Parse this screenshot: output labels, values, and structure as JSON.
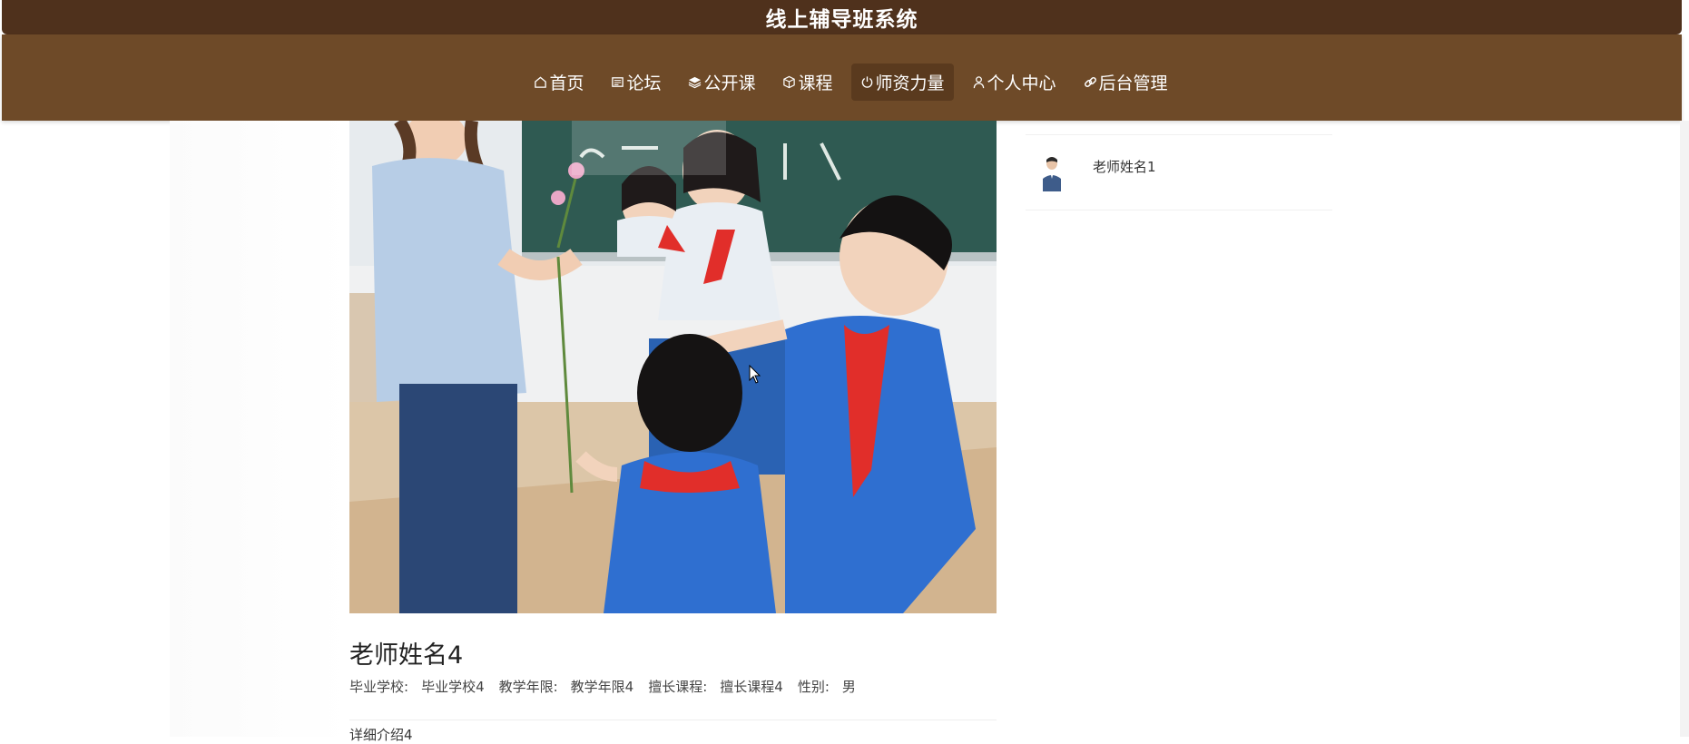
{
  "header": {
    "title": "线上辅导班系统"
  },
  "nav": {
    "items": [
      {
        "label": "首页",
        "icon": "home-icon"
      },
      {
        "label": "论坛",
        "icon": "forum-icon"
      },
      {
        "label": "公开课",
        "icon": "layers-icon"
      },
      {
        "label": "课程",
        "icon": "box-icon"
      },
      {
        "label": "师资力量",
        "icon": "power-icon",
        "active": true
      },
      {
        "label": "个人中心",
        "icon": "user-icon"
      },
      {
        "label": "后台管理",
        "icon": "link-icon"
      }
    ]
  },
  "teacher": {
    "name": "老师姓名4",
    "fields": [
      {
        "label": "毕业学校:",
        "value": "毕业学校4"
      },
      {
        "label": "教学年限:",
        "value": "教学年限4"
      },
      {
        "label": "擅长课程:",
        "value": "擅长课程4"
      },
      {
        "label": "性别:",
        "value": "男"
      }
    ],
    "detail_label": "详细介绍4"
  },
  "sidebar": {
    "items": [
      {
        "name": "老师姓名1"
      }
    ]
  },
  "colors": {
    "topbar": "#4f311c",
    "navbar": "#6e4a28",
    "nav_active": "#5a3a1e"
  }
}
